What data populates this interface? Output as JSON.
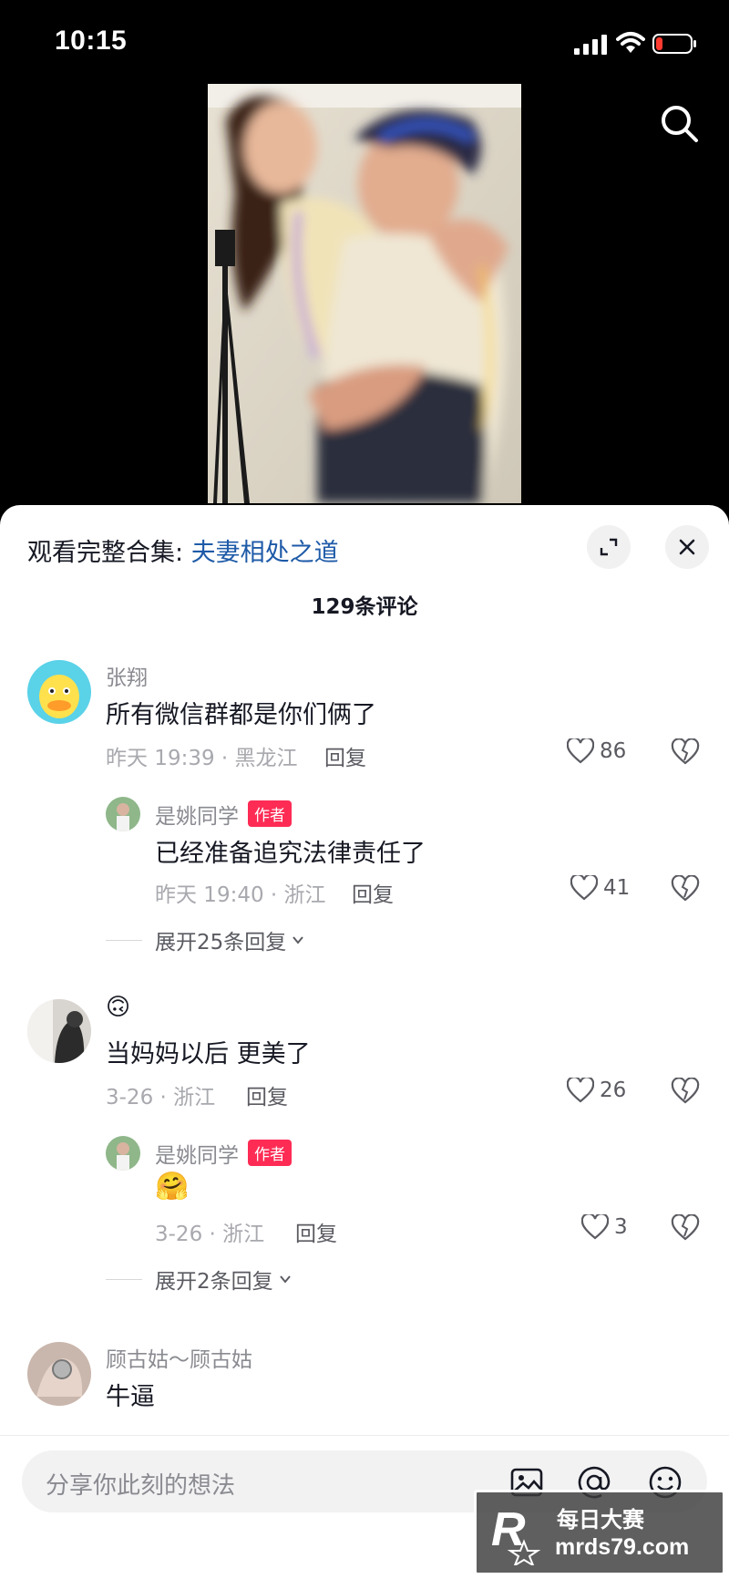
{
  "status_bar": {
    "time": "10:15",
    "battery": "low"
  },
  "panel": {
    "collection_prefix": "观看完整合集: ",
    "collection_name": "夫妻相处之道",
    "comment_count": "129条评论"
  },
  "comments": [
    {
      "username": "张翔",
      "text": "所有微信群都是你们俩了",
      "meta": "昨天 19:39 · 黑龙江",
      "reply_label": "回复",
      "likes": "86",
      "reply": {
        "username": "是姚同学",
        "badge": "作者",
        "text": "已经准备追究法律责任了",
        "meta": "昨天 19:40 · 浙江",
        "reply_label": "回复",
        "likes": "41"
      },
      "expand_label": "展开25条回复"
    },
    {
      "username": "🙃",
      "text": "当妈妈以后 更美了",
      "meta": "3-26 · 浙江",
      "reply_label": "回复",
      "likes": "26",
      "reply": {
        "username": "是姚同学",
        "badge": "作者",
        "text": "🤗",
        "meta": "3-26 · 浙江",
        "reply_label": "回复",
        "likes": "3"
      },
      "expand_label": "展开2条回复"
    },
    {
      "username": "顾古姑～顾古姑",
      "text": "牛逼"
    }
  ],
  "input": {
    "placeholder": "分享你此刻的想法"
  },
  "watermark": {
    "line1": "每日大赛",
    "line2": "mrds79.com",
    "logo_letter": "R"
  },
  "icons": {
    "signal": "signal-icon",
    "wifi": "wifi-icon",
    "battery": "battery-icon",
    "search": "search-icon",
    "expand": "expand-icon",
    "close": "close-icon",
    "heart": "heart-icon",
    "dislike": "broken-heart-icon",
    "image": "image-icon",
    "at": "at-icon",
    "emoji": "emoji-icon"
  },
  "colors": {
    "link": "#1e5aa8",
    "badge": "#fe2c55",
    "battery_low": "#ff3b30"
  }
}
